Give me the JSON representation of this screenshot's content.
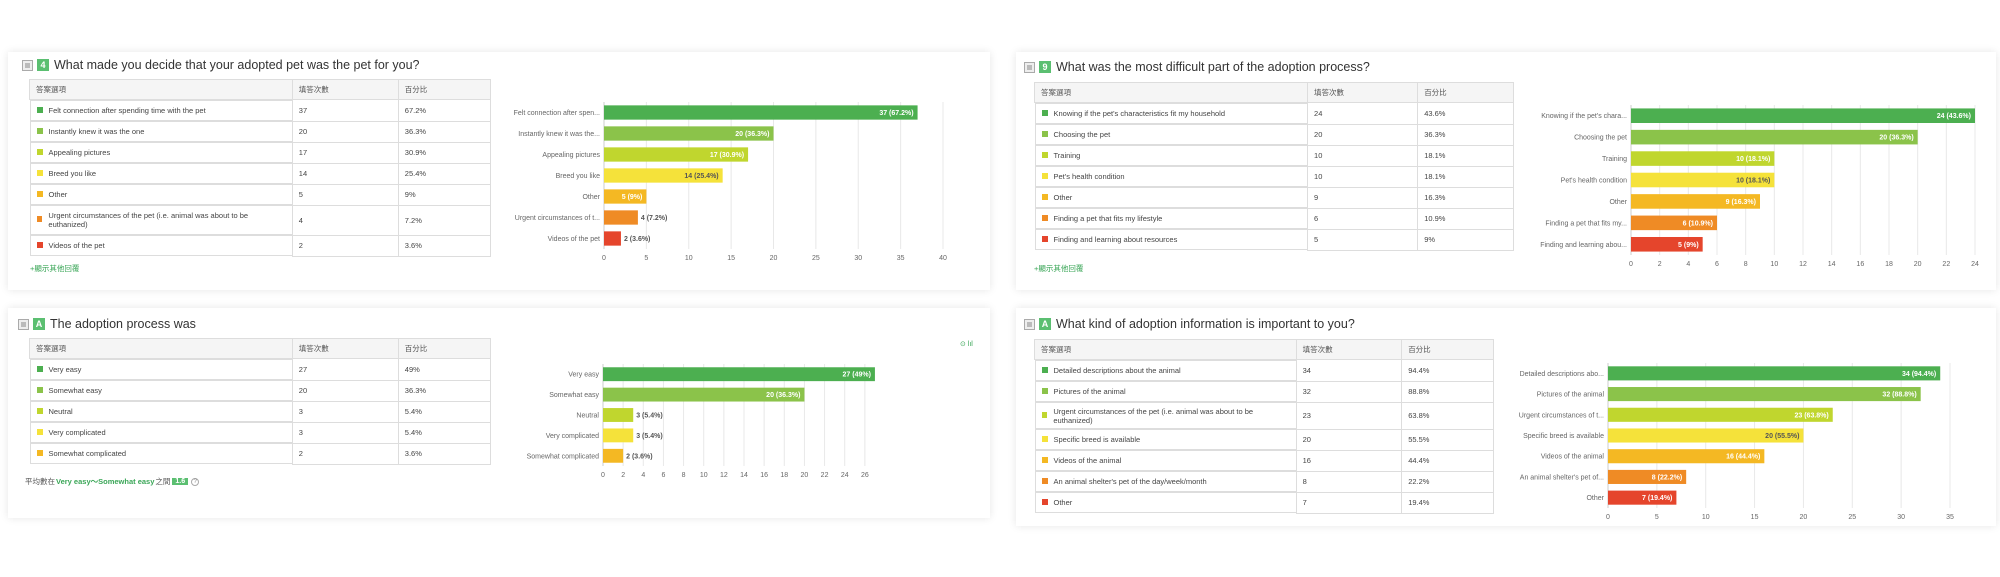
{
  "colors": [
    "#4caf50",
    "#8bc34a",
    "#c0d62e",
    "#f5e23a",
    "#f4b823",
    "#ef8b25",
    "#e5452c"
  ],
  "table_headers": {
    "option": "答案選項",
    "count": "填答次數",
    "percent": "百分比"
  },
  "questions": [
    {
      "badge": "4",
      "title": "What made you decide that your adopted pet was the pet for you?",
      "more_link": "+顯示其他回覆",
      "rows": [
        {
          "label": "Felt connection after spending time with the pet",
          "count": "37",
          "percent": "67.2%"
        },
        {
          "label": "Instantly knew it was the one",
          "count": "20",
          "percent": "36.3%"
        },
        {
          "label": "Appealing pictures",
          "count": "17",
          "percent": "30.9%"
        },
        {
          "label": "Breed you like",
          "count": "14",
          "percent": "25.4%"
        },
        {
          "label": "Other",
          "count": "5",
          "percent": "9%"
        },
        {
          "label": "Urgent circumstances of the pet (i.e. animal was about to be euthanized)",
          "count": "4",
          "percent": "7.2%"
        },
        {
          "label": "Videos of the pet",
          "count": "2",
          "percent": "3.6%"
        }
      ]
    },
    {
      "badge": "9",
      "title": "What was the most difficult part of the adoption process?",
      "more_link": "+顯示其他回覆",
      "rows": [
        {
          "label": "Knowing if the pet's characteristics fit my household",
          "count": "24",
          "percent": "43.6%"
        },
        {
          "label": "Choosing the pet",
          "count": "20",
          "percent": "36.3%"
        },
        {
          "label": "Training",
          "count": "10",
          "percent": "18.1%"
        },
        {
          "label": "Pet's health condition",
          "count": "10",
          "percent": "18.1%"
        },
        {
          "label": "Other",
          "count": "9",
          "percent": "16.3%"
        },
        {
          "label": "Finding a pet that fits my lifestyle",
          "count": "6",
          "percent": "10.9%"
        },
        {
          "label": "Finding and learning about resources",
          "count": "5",
          "percent": "9%"
        }
      ]
    },
    {
      "badge": "A",
      "title": "The adoption process was",
      "avg": {
        "prefix": "平均數在",
        "range": "Very easy～Somewhat easy",
        "mid": "之間",
        "value": "1.6",
        "help": "?"
      },
      "control": "⊙ lıl",
      "rows": [
        {
          "label": "Very easy",
          "count": "27",
          "percent": "49%"
        },
        {
          "label": "Somewhat easy",
          "count": "20",
          "percent": "36.3%"
        },
        {
          "label": "Neutral",
          "count": "3",
          "percent": "5.4%"
        },
        {
          "label": "Very complicated",
          "count": "3",
          "percent": "5.4%"
        },
        {
          "label": "Somewhat complicated",
          "count": "2",
          "percent": "3.6%"
        }
      ]
    },
    {
      "badge": "A",
      "title": "What kind of adoption information is important to you?",
      "rows": [
        {
          "label": "Detailed descriptions about the animal",
          "count": "34",
          "percent": "94.4%"
        },
        {
          "label": "Pictures of the animal",
          "count": "32",
          "percent": "88.8%"
        },
        {
          "label": "Urgent circumstances of the pet (i.e. animal was about to be euthanized)",
          "count": "23",
          "percent": "63.8%"
        },
        {
          "label": "Specific breed is available",
          "count": "20",
          "percent": "55.5%"
        },
        {
          "label": "Videos of the animal",
          "count": "16",
          "percent": "44.4%"
        },
        {
          "label": "An animal shelter's pet of the day/week/month",
          "count": "8",
          "percent": "22.2%"
        },
        {
          "label": "Other",
          "count": "7",
          "percent": "19.4%"
        }
      ]
    }
  ],
  "chart_data": [
    {
      "type": "bar",
      "orientation": "horizontal",
      "categories": [
        "Felt connection after spen...",
        "Instantly knew it was the...",
        "Appealing pictures",
        "Breed you like",
        "Other",
        "Urgent circumstances of t...",
        "Videos of the pet"
      ],
      "values": [
        37,
        20,
        17,
        14,
        5,
        4,
        2
      ],
      "data_labels": [
        "37 (67.2%)",
        "20 (36.3%)",
        "17 (30.9%)",
        "14 (25.4%)",
        "5 (9%)",
        "4 (7.2%)",
        "2 (3.6%)"
      ],
      "xticks": [
        "0",
        "5",
        "10",
        "15",
        "20",
        "25",
        "30",
        "35",
        "40"
      ],
      "xlim": [
        0,
        40
      ],
      "grid": true
    },
    {
      "type": "bar",
      "orientation": "horizontal",
      "categories": [
        "Knowing if the pet's chara...",
        "Choosing the pet",
        "Training",
        "Pet's health condition",
        "Other",
        "Finding a pet that fits my...",
        "Finding and learning abou..."
      ],
      "values": [
        24,
        20,
        10,
        10,
        9,
        6,
        5
      ],
      "data_labels": [
        "24 (43.6%)",
        "20 (36.3%)",
        "10 (18.1%)",
        "10 (18.1%)",
        "9 (16.3%)",
        "6 (10.9%)",
        "5 (9%)"
      ],
      "xticks": [
        "0",
        "2",
        "4",
        "6",
        "8",
        "10",
        "12",
        "14",
        "16",
        "18",
        "20",
        "22",
        "24"
      ],
      "xlim": [
        0,
        24
      ],
      "grid": true
    },
    {
      "type": "bar",
      "orientation": "horizontal",
      "categories": [
        "Very easy",
        "Somewhat easy",
        "Neutral",
        "Very complicated",
        "Somewhat complicated"
      ],
      "values": [
        27,
        20,
        3,
        3,
        2
      ],
      "data_labels": [
        "27 (49%)",
        "20 (36.3%)",
        "3 (5.4%)",
        "3 (5.4%)",
        "2 (3.6%)"
      ],
      "xticks": [
        "0",
        "2",
        "4",
        "6",
        "8",
        "10",
        "12",
        "14",
        "16",
        "18",
        "20",
        "22",
        "24",
        "26"
      ],
      "xlim": [
        0,
        28
      ],
      "grid": true
    },
    {
      "type": "bar",
      "orientation": "horizontal",
      "categories": [
        "Detailed descriptions abo...",
        "Pictures of the animal",
        "Urgent circumstances of t...",
        "Specific breed is available",
        "Videos of the animal",
        "An animal shelter's pet of...",
        "Other"
      ],
      "values": [
        34,
        32,
        23,
        20,
        16,
        8,
        7
      ],
      "data_labels": [
        "34 (94.4%)",
        "32 (88.8%)",
        "23 (63.8%)",
        "20 (55.5%)",
        "16 (44.4%)",
        "8 (22.2%)",
        "7 (19.4%)"
      ],
      "xticks": [
        "0",
        "5",
        "10",
        "15",
        "20",
        "25",
        "30",
        "35"
      ],
      "xlim": [
        0,
        35
      ],
      "grid": true
    }
  ]
}
